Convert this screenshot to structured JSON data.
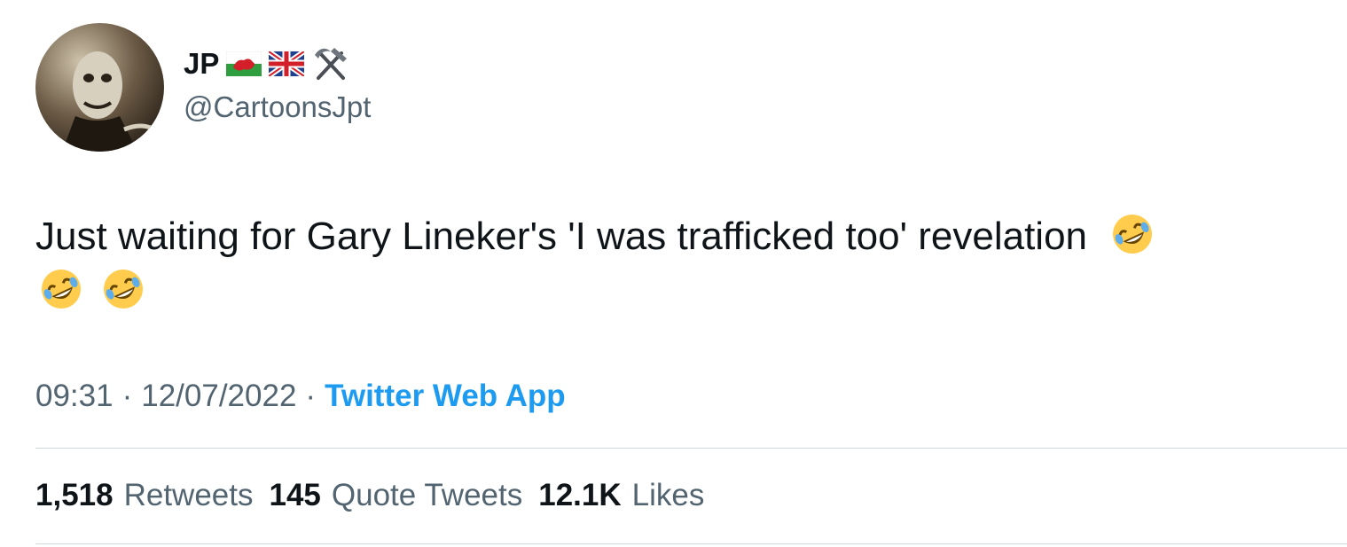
{
  "author": {
    "display_name": "JP",
    "handle": "@CartoonsJpt",
    "badges": [
      "wales-flag-icon",
      "uk-flag-icon",
      "hammer-and-pick-icon"
    ]
  },
  "tweet": {
    "text_line1": "Just waiting for Gary Lineker's 'I was trafficked too' revelation",
    "emoji": "rolling-on-floor-laughing-icon"
  },
  "meta": {
    "time": "09:31",
    "separator": "·",
    "date": "12/07/2022",
    "source": "Twitter Web App"
  },
  "stats": {
    "retweets_count": "1,518",
    "retweets_label": "Retweets",
    "quotes_count": "145",
    "quotes_label": "Quote Tweets",
    "likes_count": "12.1K",
    "likes_label": "Likes"
  },
  "colors": {
    "text": "#0f1419",
    "secondary": "#536471",
    "link": "#1d9bf0",
    "divider": "#cfd9de"
  }
}
